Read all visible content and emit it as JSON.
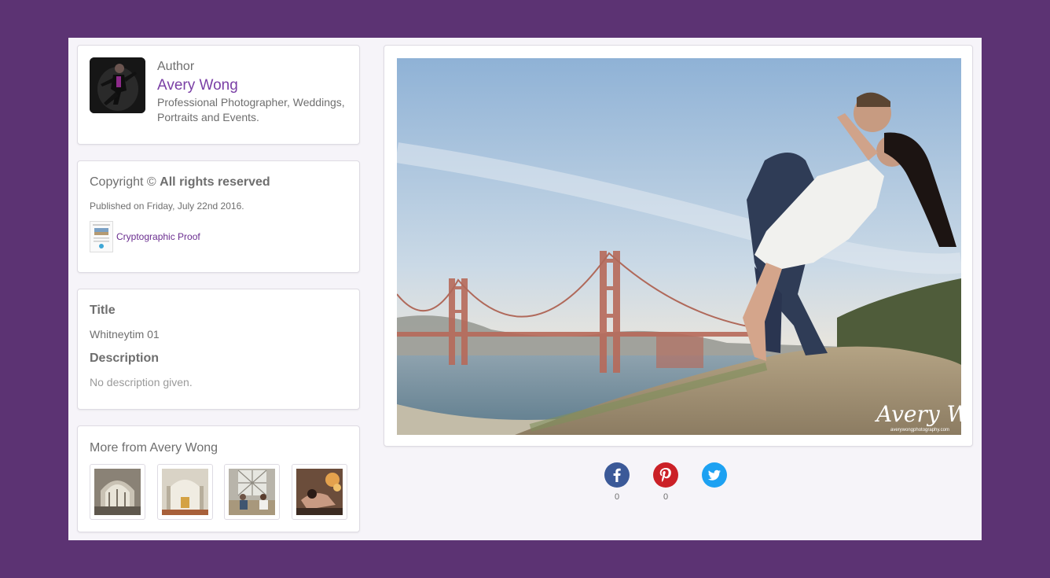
{
  "author": {
    "label": "Author",
    "name": "Avery Wong",
    "bio": "Professional Photographer, Weddings, Portraits and Events."
  },
  "copyright": {
    "prefix": "Copyright ©",
    "rights": "All rights reserved",
    "published": "Published on Friday, July 22nd 2016.",
    "proof_link": "Cryptographic Proof"
  },
  "details": {
    "title_heading": "Title",
    "title_value": "Whitneytim 01",
    "description_heading": "Description",
    "description_value": "No description given."
  },
  "more": {
    "heading": "More from Avery Wong",
    "thumbnails": [
      "thumbnail-1",
      "thumbnail-2",
      "thumbnail-3",
      "thumbnail-4"
    ]
  },
  "photo": {
    "watermark": "Avery Wong",
    "watermark_url": "averywongphotography.com"
  },
  "share": {
    "facebook_icon": "facebook-icon",
    "facebook_count": "0",
    "pinterest_icon": "pinterest-icon",
    "pinterest_count": "0",
    "twitter_icon": "twitter-icon"
  },
  "colors": {
    "background": "#5c3373",
    "accent": "#7a3fa5",
    "facebook": "#3b5998",
    "pinterest": "#cb2027",
    "twitter": "#1da1f2"
  }
}
